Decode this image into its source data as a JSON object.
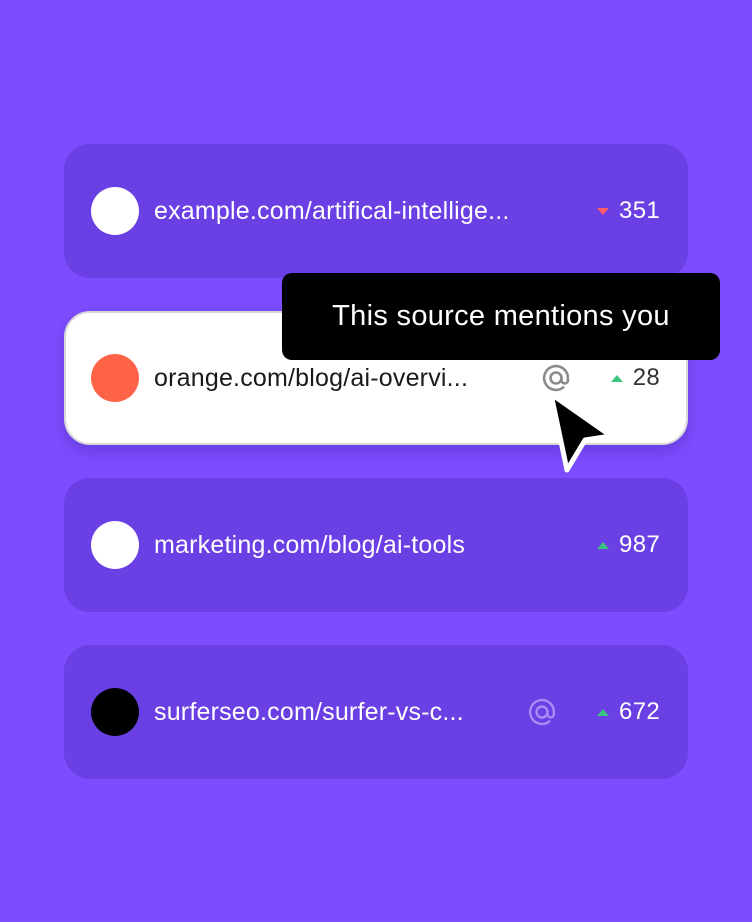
{
  "rows": [
    {
      "url": "example.com/artifical-intellige...",
      "dot_color": "#ffffff",
      "trend": "down",
      "value": "351",
      "mentions_you": false,
      "highlighted": false
    },
    {
      "url": "orange.com/blog/ai-overvi...",
      "dot_color": "#ff6347",
      "trend": "up",
      "value": "28",
      "mentions_you": true,
      "highlighted": true
    },
    {
      "url": "marketing.com/blog/ai-tools",
      "dot_color": "#ffffff",
      "trend": "up",
      "value": "987",
      "mentions_you": false,
      "highlighted": false
    },
    {
      "url": "surferseo.com/surfer-vs-c...",
      "dot_color": "#000000",
      "trend": "up",
      "value": "672",
      "mentions_you": true,
      "highlighted": false
    }
  ],
  "tooltip": {
    "text": "This source mentions you"
  },
  "icons": {
    "mention": "at-sign-icon",
    "trend_up": "triangle-up-icon",
    "trend_down": "triangle-down-icon",
    "cursor": "mouse-pointer-icon"
  },
  "colors": {
    "background": "#7c4dff",
    "row_background": "#6a3fe3",
    "highlight_background": "#ffffff",
    "trend_up": "#3bc47f",
    "trend_down": "#ff5d6c",
    "tooltip_background": "#000000"
  }
}
